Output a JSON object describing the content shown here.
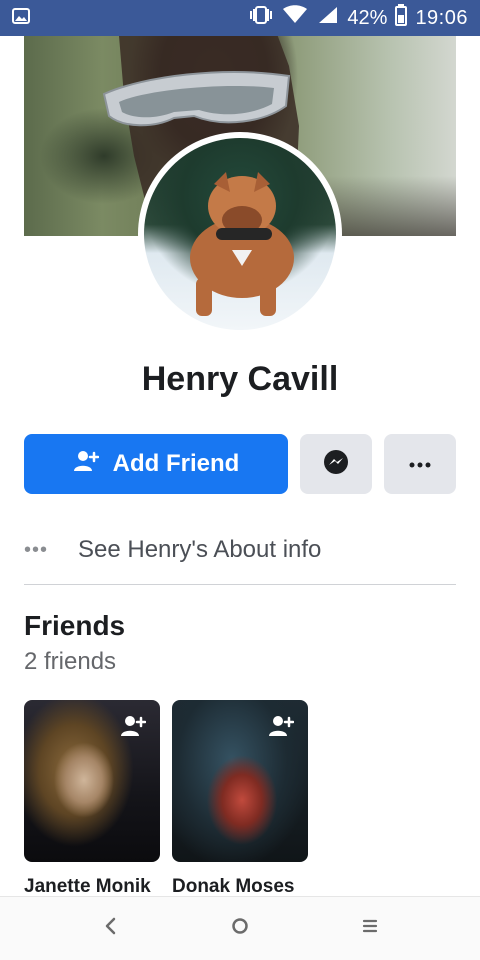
{
  "status_bar": {
    "battery": "42%",
    "time": "19:06",
    "icons": [
      "image-icon",
      "vibrate-icon",
      "wifi-icon",
      "signal-icon",
      "battery-icon"
    ]
  },
  "profile": {
    "name": "Henry Cavill"
  },
  "actions": {
    "add_friend_label": "Add Friend",
    "add_friend_color": "#1877f2",
    "more_label": "•••"
  },
  "about": {
    "label": "See Henry's About info",
    "dots": "•••"
  },
  "friends": {
    "title": "Friends",
    "count": "2 friends",
    "items": [
      {
        "name": "Janette Monik"
      },
      {
        "name": "Donak Moses"
      }
    ]
  },
  "colors": {
    "status_bar_bg": "#3b5998",
    "primary": "#1877f2",
    "secondary_button_bg": "#e4e6eb"
  }
}
